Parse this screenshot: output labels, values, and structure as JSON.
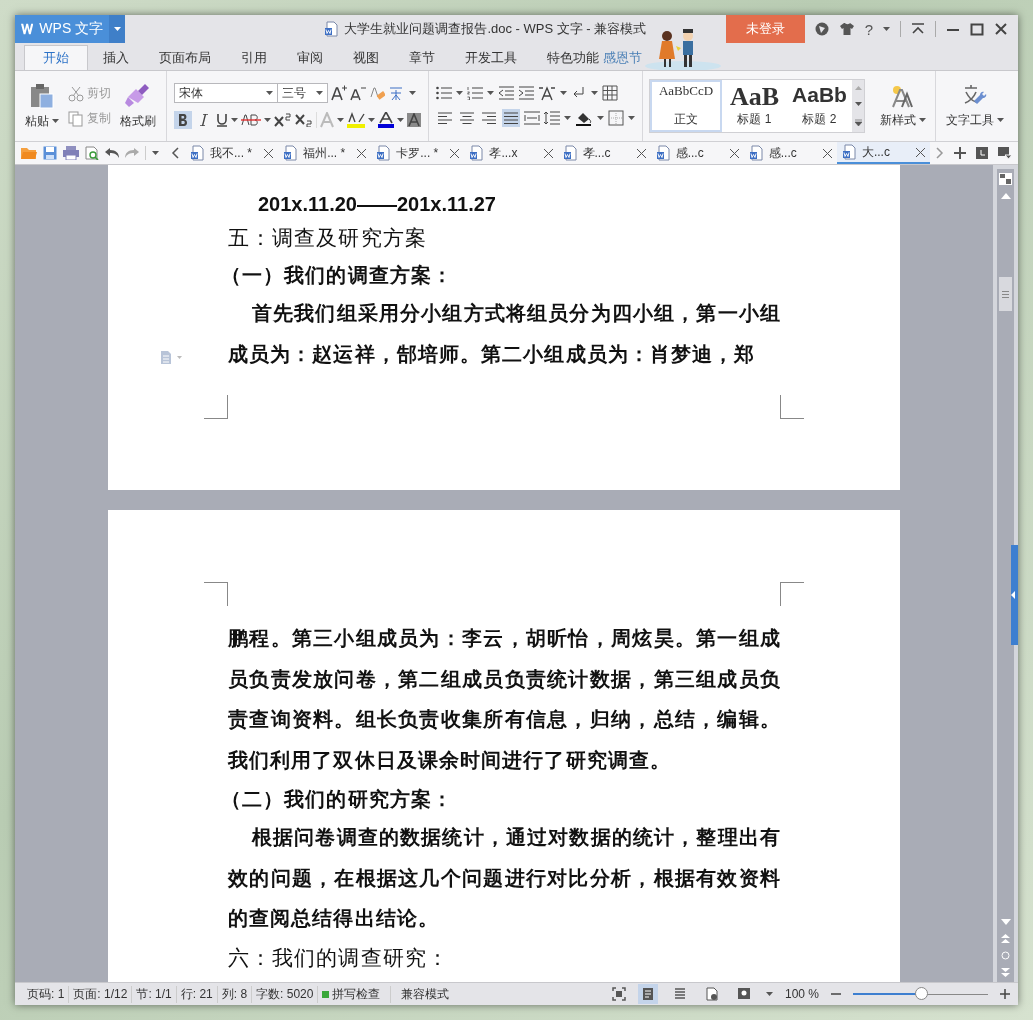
{
  "app": {
    "logo": "WPS 文字",
    "title": "大学生就业问题调查报告.doc - WPS 文字 - 兼容模式",
    "login": "未登录",
    "help": "?"
  },
  "menu_tabs": [
    {
      "label": "开始",
      "selected": true
    },
    {
      "label": "插入",
      "selected": false
    },
    {
      "label": "页面布局",
      "selected": false
    },
    {
      "label": "引用",
      "selected": false
    },
    {
      "label": "审阅",
      "selected": false
    },
    {
      "label": "视图",
      "selected": false
    },
    {
      "label": "章节",
      "selected": false
    },
    {
      "label": "开发工具",
      "selected": false
    },
    {
      "label": "特色功能",
      "selected": false
    }
  ],
  "festival": "感恩节",
  "ribbon": {
    "paste": "粘贴",
    "cut": {
      "label": "剪切",
      "disabled": true
    },
    "copy": {
      "label": "复制",
      "disabled": true
    },
    "format_painter": "格式刷",
    "font_name": "宋体",
    "font_size": "三号",
    "bold": true,
    "italic": false,
    "align_buttons": [
      {
        "kind": "left",
        "selected": false
      },
      {
        "kind": "center",
        "selected": false
      },
      {
        "kind": "right",
        "selected": false
      },
      {
        "kind": "justify",
        "selected": true
      }
    ],
    "styles": [
      {
        "preview": "AaBbCcD",
        "label": "正文",
        "kind": "normal",
        "selected": true
      },
      {
        "preview": "AaB",
        "label": "标题 1",
        "kind": "h1",
        "selected": false
      },
      {
        "preview": "AaBb",
        "label": "标题 2",
        "kind": "h2",
        "selected": false
      }
    ],
    "new_style": "新样式",
    "text_tools": "文字工具"
  },
  "doc_tabs": [
    {
      "label": "我不... *",
      "selected": false
    },
    {
      "label": "福州... *",
      "selected": false
    },
    {
      "label": "卡罗... *",
      "selected": false
    },
    {
      "label": "孝...x",
      "selected": false
    },
    {
      "label": "孝...c",
      "selected": false
    },
    {
      "label": "感...c",
      "selected": false
    },
    {
      "label": "感...c",
      "selected": false
    },
    {
      "label": "大...c",
      "selected": true
    }
  ],
  "pages": [
    {
      "paragraphs": [
        {
          "kind": "date",
          "text": "201x.11.20——201x.11.27"
        },
        {
          "kind": "heading",
          "text": "五：调查及研究方案"
        },
        {
          "kind": "subheading",
          "text": "（一）我们的调查方案："
        },
        {
          "kind": "body",
          "indent": true,
          "text": "首先我们组采用分小组方式将组员分为四小组，第一小组成员为：赵运祥，郜培师。第二小组成员为：肖梦迪，郑"
        }
      ]
    },
    {
      "paragraphs": [
        {
          "kind": "body",
          "indent": false,
          "text": "鹏程。第三小组成员为：李云，胡昕怡，周炫昊。第一组成员负责发放问卷，第二组成员负责统计数据，第三组成员负责查询资料。组长负责收集所有信息，归纳，总结，编辑。我们利用了双休日及课余时间进行了研究调查。"
        },
        {
          "kind": "subheading",
          "text": "（二）我们的研究方案："
        },
        {
          "kind": "body",
          "indent": true,
          "text": "根据问卷调查的数据统计，通过对数据的统计，整理出有效的问题，在根据这几个问题进行对比分析，根据有效资料的查阅总结得出结论。"
        },
        {
          "kind": "heading",
          "text": "六：我们的调查研究："
        }
      ]
    }
  ],
  "status_bar": {
    "items": [
      "页码: 1",
      "页面: 1/12",
      "节: 1/1",
      "行: 21",
      "列: 8",
      "字数: 5020"
    ],
    "spell_check": "拼写检查",
    "mode": "兼容模式",
    "views": [
      {
        "kind": "page",
        "selected": true
      },
      {
        "kind": "outline",
        "selected": false
      },
      {
        "kind": "web",
        "selected": false
      },
      {
        "kind": "reading",
        "selected": false
      }
    ],
    "zoom": "100 %",
    "zoom_slider": {
      "level": 0.5
    }
  }
}
